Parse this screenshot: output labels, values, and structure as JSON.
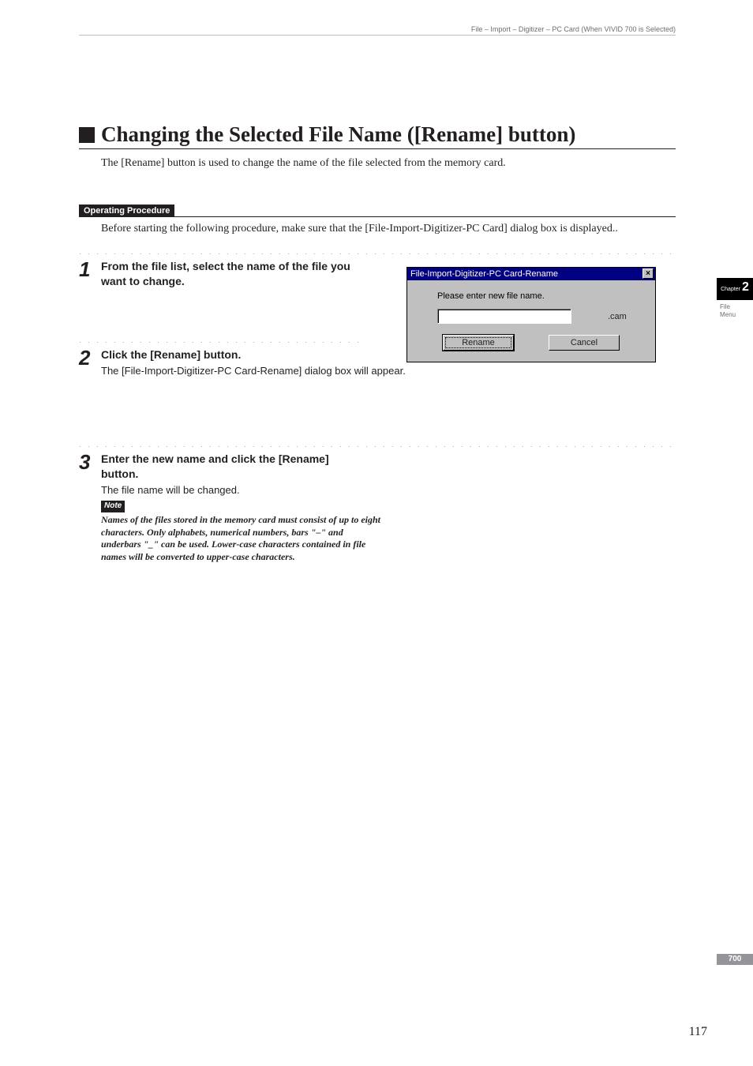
{
  "header": "File – Import – Digitizer – PC Card (When VIVID 700 is Selected)",
  "section_title": "Changing the Selected File Name ([Rename] button)",
  "intro": "The [Rename] button is used to change the name of the file selected from the memory card.",
  "op_label": "Operating Procedure",
  "before": "Before starting the following procedure, make sure that the [File-Import-Digitizer-PC Card] dialog box is displayed..",
  "step1": {
    "num": "1",
    "head": "From the file list, select the name of the file you want to change."
  },
  "step2": {
    "num": "2",
    "head": "Click the [Rename] button.",
    "desc": "The [File-Import-Digitizer-PC Card-Rename] dialog box will appear."
  },
  "step3": {
    "num": "3",
    "head": "Enter the new name and click the [Rename] button.",
    "desc": "The file name will be changed.",
    "note_label": "Note",
    "note_body": "Names of the files stored in the memory card must consist of up to eight characters. Only alphabets, numerical numbers, bars \"–\" and underbars \"_\" can be used. Lower-case characters contained in file names will be converted to upper-case characters."
  },
  "dialog": {
    "title": "File-Import-Digitizer-PC Card-Rename",
    "msg": "Please enter new file name.",
    "ext": ".cam",
    "rename": "Rename",
    "cancel": "Cancel",
    "close_glyph": "×"
  },
  "sidebar": {
    "chapter_small": "Chapter",
    "chapter_num": "2",
    "line1": "File",
    "line2": "Menu"
  },
  "badge": "700",
  "page_num": "117",
  "dots_full": ". . . . . . . . . . . . . . . . . . . . . . . . . . . . . . . . . . . . . . . . . . . . . . . . . . . . . . . . . . . . . . . . . . . . . . . . . . . . . . . . . . . . . . . . . . . . . . . . . . . . . . . . . . . . . . . . . . . . . . . .",
  "dots_half": ". . . . . . . . . . . . . . . . . . . . . . . . . . . . . . . . . . . . . . . . . . . . . . . . . . . . . ."
}
